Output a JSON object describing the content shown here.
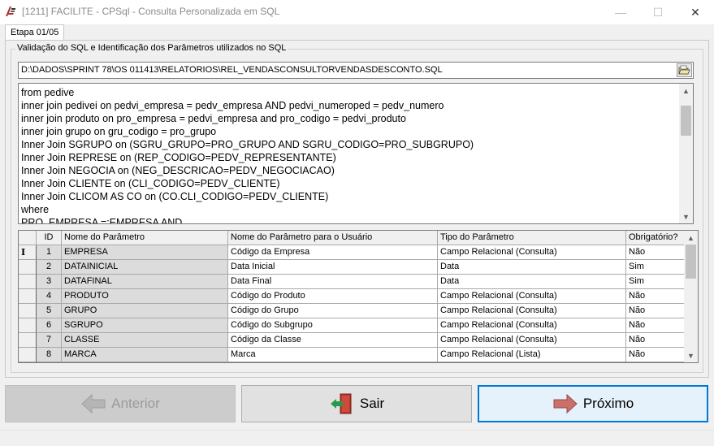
{
  "window": {
    "title": "[1211] FACILITE - CPSql - Consulta Personalizada em SQL",
    "minimize": "—",
    "maximize": "☐",
    "close": "✕"
  },
  "tabs": [
    {
      "label": "Etapa 01/05"
    }
  ],
  "group": {
    "title": "Validação do SQL e Identificação dos Parâmetros utilizados no SQL"
  },
  "file_path": "D:\\DADOS\\SPRINT 78\\OS 011413\\RELATORIOS\\REL_VENDASCONSULTORVENDASDESCONTO.SQL",
  "sql_lines": [
    "from pedive",
    "inner join pedivei on pedvi_empresa = pedv_empresa AND pedvi_numeroped = pedv_numero",
    "inner join produto on pro_empresa = pedvi_empresa and pro_codigo = pedvi_produto",
    "inner join grupo on gru_codigo = pro_grupo",
    "Inner Join SGRUPO on (SGRU_GRUPO=PRO_GRUPO AND SGRU_CODIGO=PRO_SUBGRUPO)",
    "Inner Join REPRESE on (REP_CODIGO=PEDV_REPRESENTANTE)",
    "Inner Join NEGOCIA on (NEG_DESCRICAO=PEDV_NEGOCIACAO)",
    "Inner Join CLIENTE on (CLI_CODIGO=PEDV_CLIENTE)",
    "Inner Join CLICOM AS CO on (CO.CLI_CODIGO=PEDV_CLIENTE)",
    "where",
    "  PRO_EMPRESA   =:EMPRESA AND"
  ],
  "grid": {
    "columns": [
      "ID",
      "Nome do Parâmetro",
      "Nome do Parâmetro para o Usuário",
      "Tipo do Parâmetro",
      "Obrigatório?"
    ],
    "current_row_marker": "I",
    "rows": [
      [
        "1",
        "EMPRESA",
        "Código da Empresa",
        "Campo Relacional (Consulta)",
        "Não"
      ],
      [
        "2",
        "DATAINICIAL",
        "Data Inicial",
        "Data",
        "Sim"
      ],
      [
        "3",
        "DATAFINAL",
        "Data Final",
        "Data",
        "Sim"
      ],
      [
        "4",
        "PRODUTO",
        "Código do Produto",
        "Campo Relacional (Consulta)",
        "Não"
      ],
      [
        "5",
        "GRUPO",
        "Código do Grupo",
        "Campo Relacional (Consulta)",
        "Não"
      ],
      [
        "6",
        "SGRUPO",
        "Código do Subgrupo",
        "Campo Relacional (Consulta)",
        "Não"
      ],
      [
        "7",
        "CLASSE",
        "Código da Classe",
        "Campo Relacional (Consulta)",
        "Não"
      ],
      [
        "8",
        "MARCA",
        "Marca",
        "Campo Relacional (Lista)",
        "Não"
      ]
    ]
  },
  "buttons": {
    "previous": "Anterior",
    "exit": "Sair",
    "next": "Próximo"
  },
  "icons": {
    "app": "facilite-logo-icon",
    "browse": "open-folder-icon",
    "previous": "arrow-left-icon",
    "exit": "exit-door-icon",
    "next": "arrow-right-icon"
  },
  "colors": {
    "accent": "#0078d7",
    "arrow_red": "#c0392b"
  }
}
